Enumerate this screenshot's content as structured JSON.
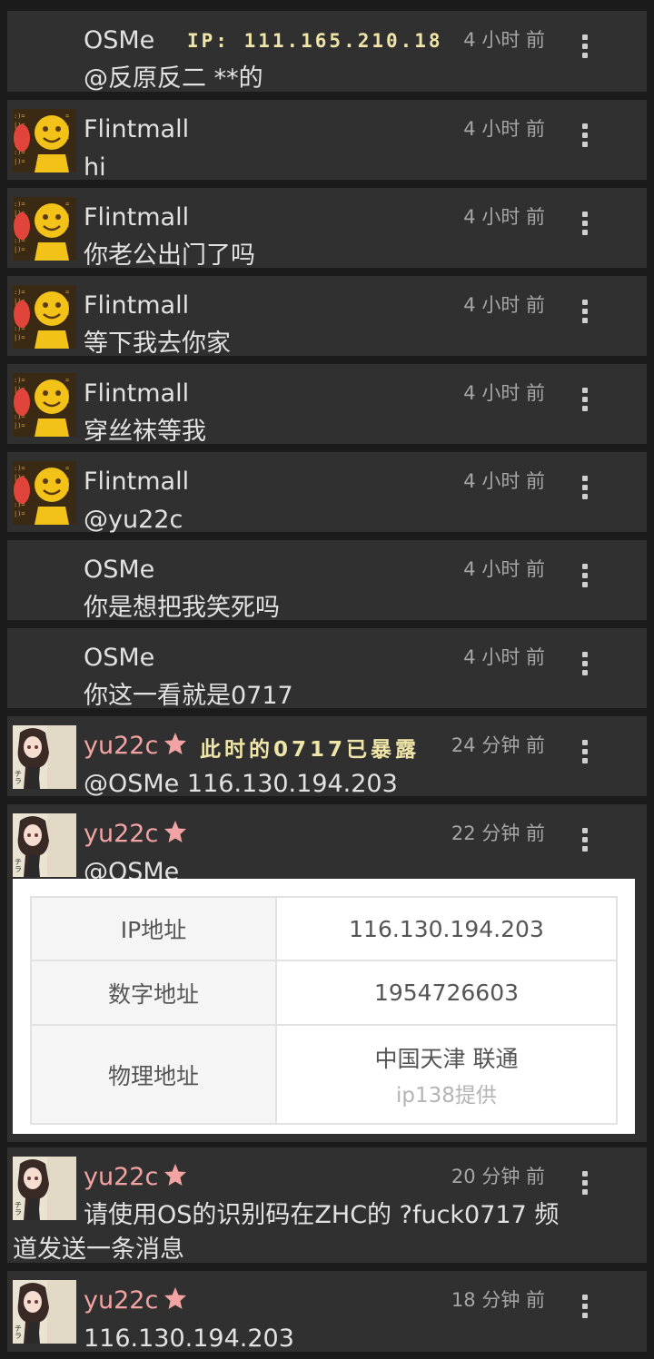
{
  "messages": [
    {
      "user": "OSMe",
      "ip": "IP: 111.165.210.18",
      "time": "4 小时 前",
      "text": "@反原反二 **的"
    },
    {
      "user": "Flintmall",
      "time": "4 小时 前",
      "text": "hi"
    },
    {
      "user": "Flintmall",
      "time": "4 小时 前",
      "text": "你老公出门了吗"
    },
    {
      "user": "Flintmall",
      "time": "4 小时 前",
      "text": "等下我去你家"
    },
    {
      "user": "Flintmall",
      "time": "4 小时 前",
      "text": "穿丝袜等我"
    },
    {
      "user": "Flintmall",
      "time": "4 小时 前",
      "text": "@yu22c"
    },
    {
      "user": "OSMe",
      "time": "4 小时 前",
      "text": "你是想把我笑死吗"
    },
    {
      "user": "OSMe",
      "time": "4 小时 前",
      "text": "你这一看就是0717"
    },
    {
      "user": "yu22c",
      "note": "此时的0717已暴露",
      "time": "24 分钟 前",
      "mention": "@OSMe",
      "text": "116.130.194.203"
    },
    {
      "user": "yu22c",
      "time": "22 分钟 前",
      "text": "@OSMe"
    },
    {
      "user": "yu22c",
      "time": "20 分钟 前",
      "text": "请使用OS的识别码在ZHC的 ?fuck0717 频道发送一条消息"
    },
    {
      "user": "yu22c",
      "time": "18 分钟 前",
      "text": "116.130.194.203"
    }
  ],
  "ip_card": {
    "rows": [
      {
        "label": "IP地址",
        "value": "116.130.194.203"
      },
      {
        "label": "数字地址",
        "value": "1954726603"
      },
      {
        "label": "物理地址",
        "value": "中国天津 联通",
        "source": "ip138提供"
      }
    ]
  },
  "colors": {
    "bubble": "#303030",
    "background": "#1b1b1b",
    "username_star_user": "#f2a3a3",
    "highlight": "#f0e5a8",
    "time": "#a6a6a6"
  },
  "icons": [
    "more-vert-icon",
    "star-icon",
    "avatar-flintmall",
    "avatar-yu22c"
  ]
}
